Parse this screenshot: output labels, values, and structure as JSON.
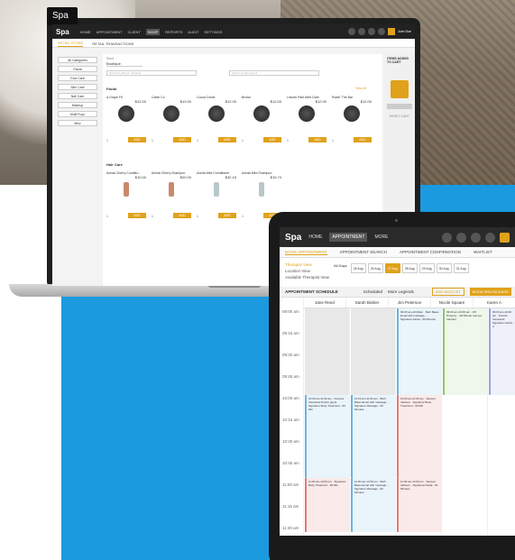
{
  "corner_logo": "Spa",
  "laptop": {
    "brand": "Spa",
    "nav": [
      "HOME",
      "APPOINTMENT",
      "CLIENT",
      "SHOP",
      "REPORTS",
      "AUDIT",
      "SETTINGS"
    ],
    "active_nav": "SHOP",
    "user": "John Doe",
    "subtabs": [
      "RETAIL STORE",
      "RETAIL TRANSACTIONS"
    ],
    "categories": [
      "All Categories",
      "Facial",
      "Foot Care",
      "Skin Care",
      "Nail Care",
      "Makeup",
      "Multi Fuyu",
      "Misc"
    ],
    "store_label": "Store",
    "store_value": "Boutique",
    "search_placeholder_1": "Search by Brand / Product",
    "search_placeholder_2": "Search by Barcode #",
    "section1": "Facial",
    "view_all": "View All",
    "products1": [
      {
        "name": "A Grape Fit",
        "price": "$12.00"
      },
      {
        "name": "Cable Co",
        "price": "$12.00"
      },
      {
        "name": "Cocoa Dome",
        "price": "$12.00"
      },
      {
        "name": "Brown",
        "price": "$12.00"
      },
      {
        "name": "Lincoln Park After Dark",
        "price": "$12.00"
      },
      {
        "name": "Rubin' The Bar",
        "price": "$12.00"
      }
    ],
    "section2": "Hair Care",
    "products2": [
      {
        "name": "Aveda Cherry Conditio...",
        "price": "$10.00"
      },
      {
        "name": "Aveda Cherry Shampoo",
        "price": "$20.00"
      },
      {
        "name": "Aveda Mint Conditioner",
        "price": "$32.15"
      },
      {
        "name": "Aveda Mint Shampoo",
        "price": "$15.70"
      }
    ],
    "add_label": "ADD",
    "qty": "1",
    "cart_title": "ITEMS ADDED TO CART",
    "cart_reset": "RESET CART"
  },
  "tablet": {
    "brand": "Spa",
    "nav": [
      "HOME",
      "APPOINTMENT",
      "MORE"
    ],
    "active_nav": "APPOINTMENT",
    "tabs": [
      "BOOK APPOINTMENT",
      "APPOINTMENT SEARCH",
      "APPOINTMENT CONFIRMATION",
      "WAITLIST"
    ],
    "views": [
      "Therapist View",
      "Location View",
      "Available Therapist View"
    ],
    "all_days": "All Days",
    "dates": [
      "25 Aug",
      "26 Aug",
      "27 Aug",
      "28 Aug",
      "29 Aug",
      "30 Aug",
      "31 Aug"
    ],
    "active_date": "27 Aug",
    "schedule_title": "APPOINTMENT SCHEDULE",
    "scheduled": "Scheduled",
    "more_legends": "More Legends",
    "add_waitlist": "ADD WAITLIST",
    "book_package": "BOOK SPA PACKAGE",
    "staff": [
      "Jane Reed",
      "Sarah Bickler",
      "Jim Peterson",
      "Nicole Spoare",
      "Karen A"
    ],
    "times": [
      "09:00 am",
      "09:15 am",
      "09:30 am",
      "09:45 am",
      "10:00 am",
      "10:15 am",
      "10:30 am",
      "10:45 am",
      "11:00 am",
      "11:15 am",
      "11:30 am"
    ],
    "blocks": {
      "jim1": "09:00 am-10:00am · Beth Bates Email with massage... · Signature Facial - 60 Minutes",
      "nicole1": "09:00 am-10:00 am · Off Property · (30 Minute reserve transfer)",
      "karen1": "09:00 am-10:00 am · Francis Cleveland · Signature Facial - 4",
      "jane2": "10:00 am-11:00 am · Frances Cleveland Parent guest · Signature Body Treatment - 60 Min",
      "sarah2": "10:00 am-11:00 am · Beth Bates Email with massage... · Signature Massage - 60 Minutes",
      "jim2": "10:00 am-11:00 am · Samuel Jackson · Signature Body Treatment - 60 Min",
      "jane3": "11:00 am-12:00 pm · Signature Body Treatment - 60 Min",
      "sarah3": "11:00 am-12:00 pm · Beth Bates Email with massage... · Signature Massage - 90 Minutes",
      "jim3": "11:00 am-12:00 pm · Samuel Jackson · Signature Facial - 60 Minutes"
    }
  }
}
